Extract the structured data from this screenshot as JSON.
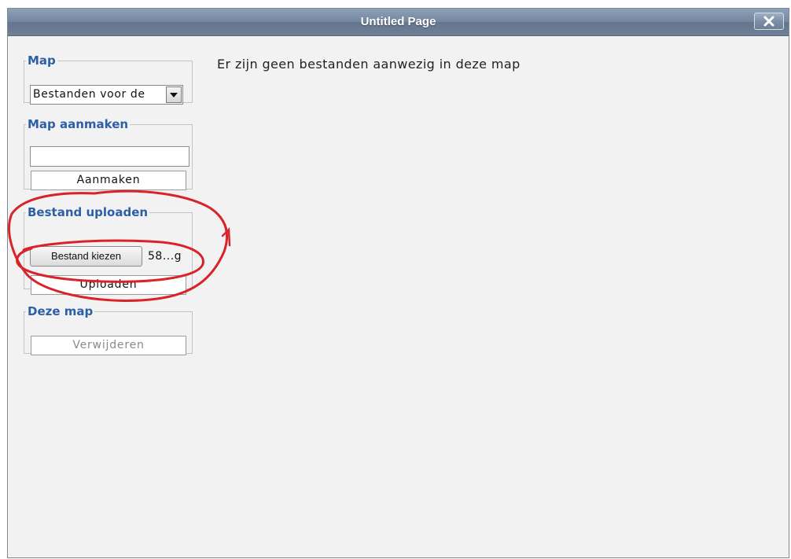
{
  "window": {
    "title": "Untitled Page",
    "close_icon": "close-x-icon"
  },
  "map_section": {
    "legend": "Map",
    "select_value": "Bestanden voor de",
    "dropdown_icon": "chevron-down-icon"
  },
  "create_section": {
    "legend": "Map aanmaken",
    "input_value": "",
    "button_label": "Aanmaken"
  },
  "upload_section": {
    "legend": "Bestand uploaden",
    "choose_button_label": "Bestand kiezen",
    "chosen_file_label": "58...g",
    "upload_button_label": "Uploaden"
  },
  "folder_section": {
    "legend": "Deze map",
    "delete_button_label": "Verwijderen"
  },
  "main": {
    "empty_message": "Er zijn geen bestanden aanwezig in deze map"
  },
  "colors": {
    "legend": "#2d5fa6",
    "title_bar": "#73869e",
    "annotation": "#d9232a"
  }
}
